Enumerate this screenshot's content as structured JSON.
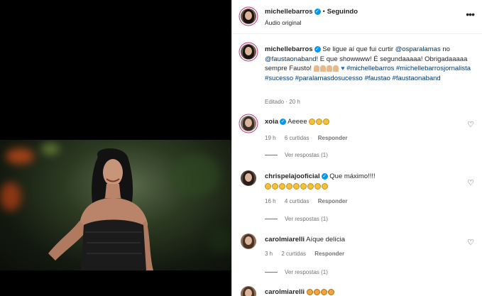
{
  "post": {
    "username": "michellebarros",
    "follow_status": "Seguindo",
    "audio": "Áudio original",
    "caption_prefix": "Se ligue aí que fui curtir",
    "mention1": "@osparalamas",
    "mid1": "no",
    "mention2": "@faustaonaband",
    "caption_middle": "! E que showwww! É segundaaaaa! Obrigadaaaaa sempre Fausto!",
    "hashtags": "#michellebarros #michellebarrosjornalista #sucesso #paralamasdosucesso #faustao #faustaonaband",
    "edited": "Editado · 20 h"
  },
  "comments": [
    {
      "username": "xoia",
      "text": "Aeeee",
      "time": "19 h",
      "likes": "6 curtidas",
      "reply_label": "Responder",
      "view_replies": "Ver respostas (1)"
    },
    {
      "username": "chrispelajooficial",
      "text": "Que máximo!!!!",
      "time": "16 h",
      "likes": "4 curtidas",
      "reply_label": "Responder",
      "view_replies": "Ver respostas (1)"
    },
    {
      "username": "carolmiarelli",
      "text": "Aíque delícia",
      "time": "3 h",
      "likes": "2 curtidas",
      "reply_label": "Responder",
      "view_replies": "Ver respostas (1)"
    },
    {
      "username": "carolmiarelli",
      "text": ""
    }
  ],
  "icons": {
    "more": "more-options-icon",
    "like": "heart-outline-icon",
    "verified": "verified-badge-icon"
  },
  "colors": {
    "verified": "#0095f6",
    "link": "#00376b",
    "meta": "#737373"
  }
}
